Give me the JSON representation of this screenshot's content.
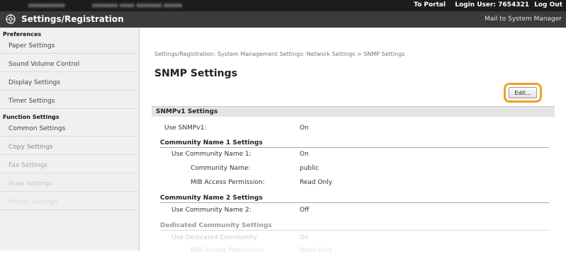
{
  "topbar": {
    "portal_link": "To Portal",
    "login_user": "Login User: 7654321",
    "logout": "Log Out"
  },
  "header": {
    "title": "Settings/Registration",
    "mail_link": "Mail to System Manager"
  },
  "sidebar": {
    "preferences_heading": "Preferences",
    "preferences_items": [
      "Paper Settings",
      "Sound Volume Control",
      "Display Settings",
      "Timer Settings"
    ],
    "function_heading": "Function Settings",
    "function_items": [
      "Common Settings",
      "Copy Settings",
      "Fax Settings",
      "Scan Settings",
      "Printer Settings"
    ]
  },
  "main": {
    "breadcrumb": "Settings/Registration: System Management Settings: Network Settings > SNMP Settings",
    "title": "SNMP Settings",
    "edit_label": "Edit...",
    "section_title": "SNMPv1 Settings",
    "use_snmpv1_label": "Use SNMPv1:",
    "use_snmpv1_value": "On",
    "community1_heading": "Community Name 1 Settings",
    "use_community1_label": "Use Community Name 1:",
    "use_community1_value": "On",
    "community_name_label": "Community Name:",
    "community_name_value": "public",
    "mib_access_label": "MIB Access Permission:",
    "mib_access_value": "Read Only",
    "community2_heading": "Community Name 2 Settings",
    "use_community2_label": "Use Community Name 2:",
    "use_community2_value": "Off",
    "dedicated_heading": "Dedicated Community Settings",
    "use_dedicated_label": "Use Dedicated Community:",
    "use_dedicated_value": "On",
    "dedicated_mib_label": "MIB Access Permission:",
    "dedicated_mib_value": "Read Only"
  },
  "colors": {
    "highlight": "#f0a020",
    "topbar": "#1c1c1c",
    "titlebar": "#3b3b3b"
  }
}
